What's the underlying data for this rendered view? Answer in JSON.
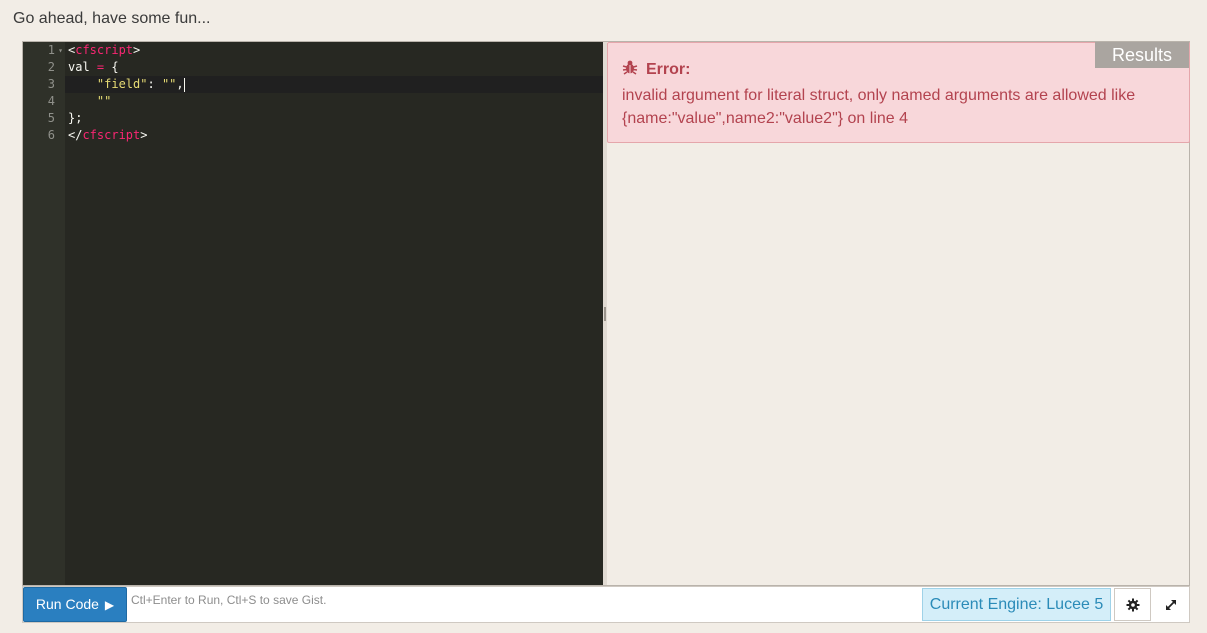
{
  "intro_text": "Go ahead, have some fun...",
  "editor": {
    "line_numbers": [
      "1",
      "2",
      "3",
      "4",
      "5",
      "6"
    ]
  },
  "results": {
    "label": "Results",
    "error_title": "Error:",
    "error_message": "invalid argument for literal struct, only named arguments are allowed like {name:\"value\",name2:\"value2\"} on line 4"
  },
  "bottom": {
    "run_label": "Run Code",
    "hint": "Ctl+Enter to Run, Ctl+S to save Gist.",
    "engine": "Current Engine: Lucee 5"
  },
  "colors": {
    "editor_bg": "#272822",
    "keyword": "#f92672",
    "string": "#e6db74",
    "error_bg": "#f8d7da",
    "error_text": "#b3434f",
    "run_button": "#2a7fc0",
    "engine_bg": "#d4eef9"
  },
  "icons": {
    "bug": "bug-icon",
    "play": "play-icon",
    "settings": "gear-icon",
    "expand": "expand-icon"
  }
}
